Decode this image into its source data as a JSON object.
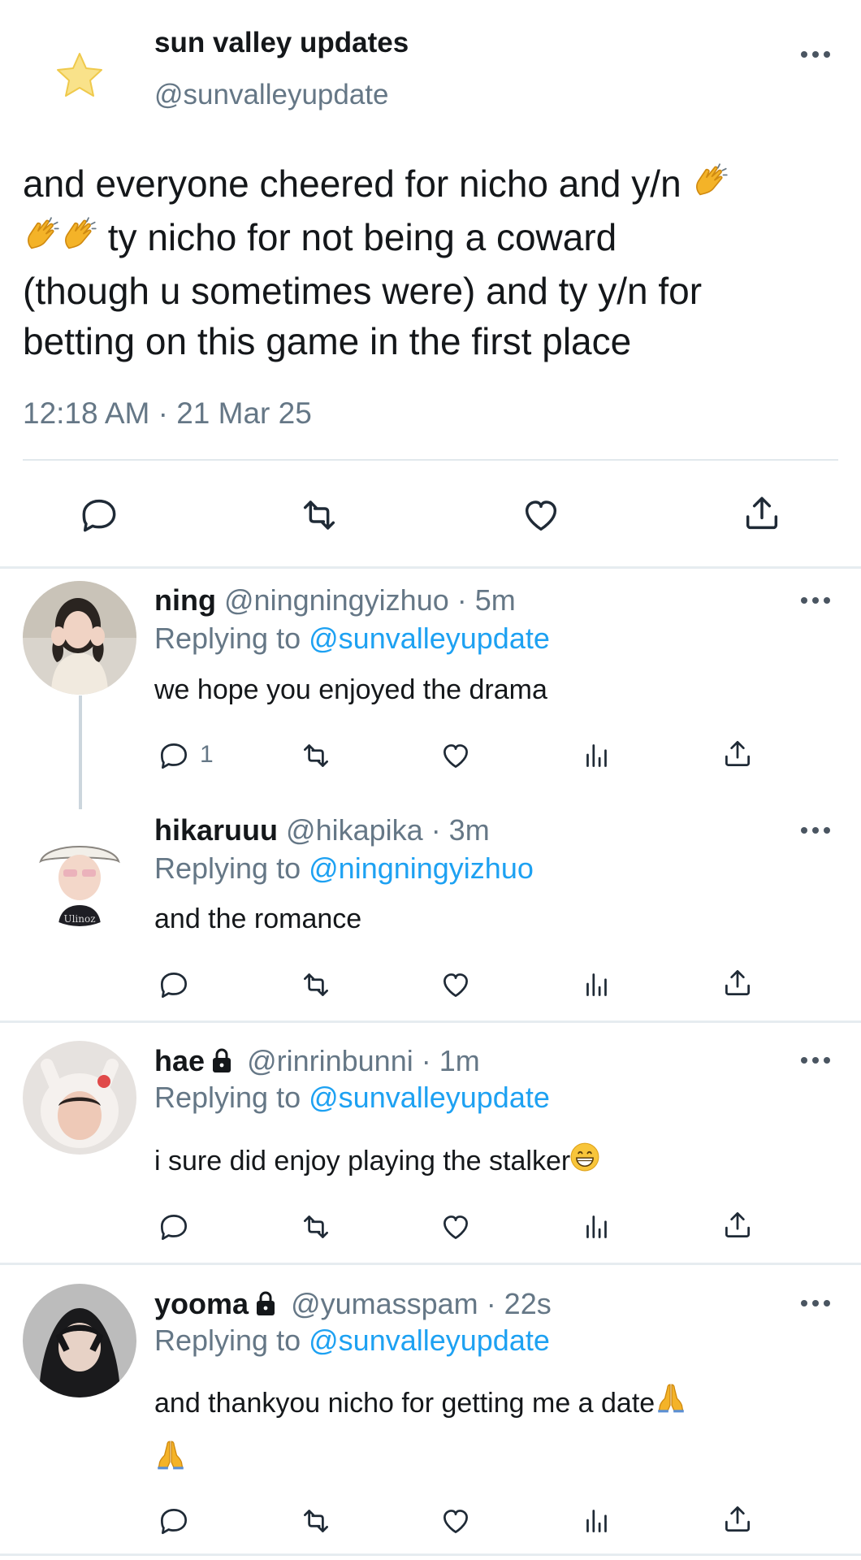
{
  "main_tweet": {
    "author_name": "sun valley updates",
    "author_handle": "@sunvalleyupdate",
    "text_lines": [
      "and everyone cheered for nicho and y/n",
      "ty nicho for not being a coward",
      "(though u sometimes were) and ty y/n for",
      "betting on this game in the first place"
    ],
    "timestamp": "12:18 AM · 21 Mar 25",
    "actions": [
      "reply-icon",
      "retweet-icon",
      "like-icon",
      "share-icon"
    ]
  },
  "replies": [
    {
      "name": "ning",
      "handle": "@ningningyizhuo",
      "time": "· 5m",
      "replying_prefix": "Replying to",
      "replying_to": "@sunvalleyupdate",
      "text": "we hope you enjoyed the drama",
      "reply_count": "1",
      "locked": false
    },
    {
      "name": "hikaruuu",
      "handle": "@hikapika",
      "time": "· 3m",
      "replying_prefix": "Replying to",
      "replying_to": "@ningningyizhuo",
      "text": "and the romance",
      "reply_count": "",
      "locked": false
    },
    {
      "name": "hae",
      "handle": "@rinrinbunni",
      "time": "· 1m",
      "replying_prefix": "Replying to",
      "replying_to": "@sunvalleyupdate",
      "text": "i sure did enjoy playing the stalker",
      "reply_count": "",
      "locked": true
    },
    {
      "name": "yooma",
      "handle": "@yumasspam",
      "time": "· 22s",
      "replying_prefix": "Replying to",
      "replying_to": "@sunvalleyupdate",
      "text": "and thankyou nicho for getting me a date",
      "reply_count": "",
      "locked": true
    }
  ],
  "colors": {
    "link": "#1da1f2",
    "secondary_text": "#657786",
    "divider": "#e6ecf0"
  },
  "icons": [
    "star-emoji-avatar",
    "clapping-hands-emoji",
    "grinning-emoji",
    "folded-hands-emoji",
    "lock-icon",
    "more-options-icon",
    "views-icon"
  ]
}
